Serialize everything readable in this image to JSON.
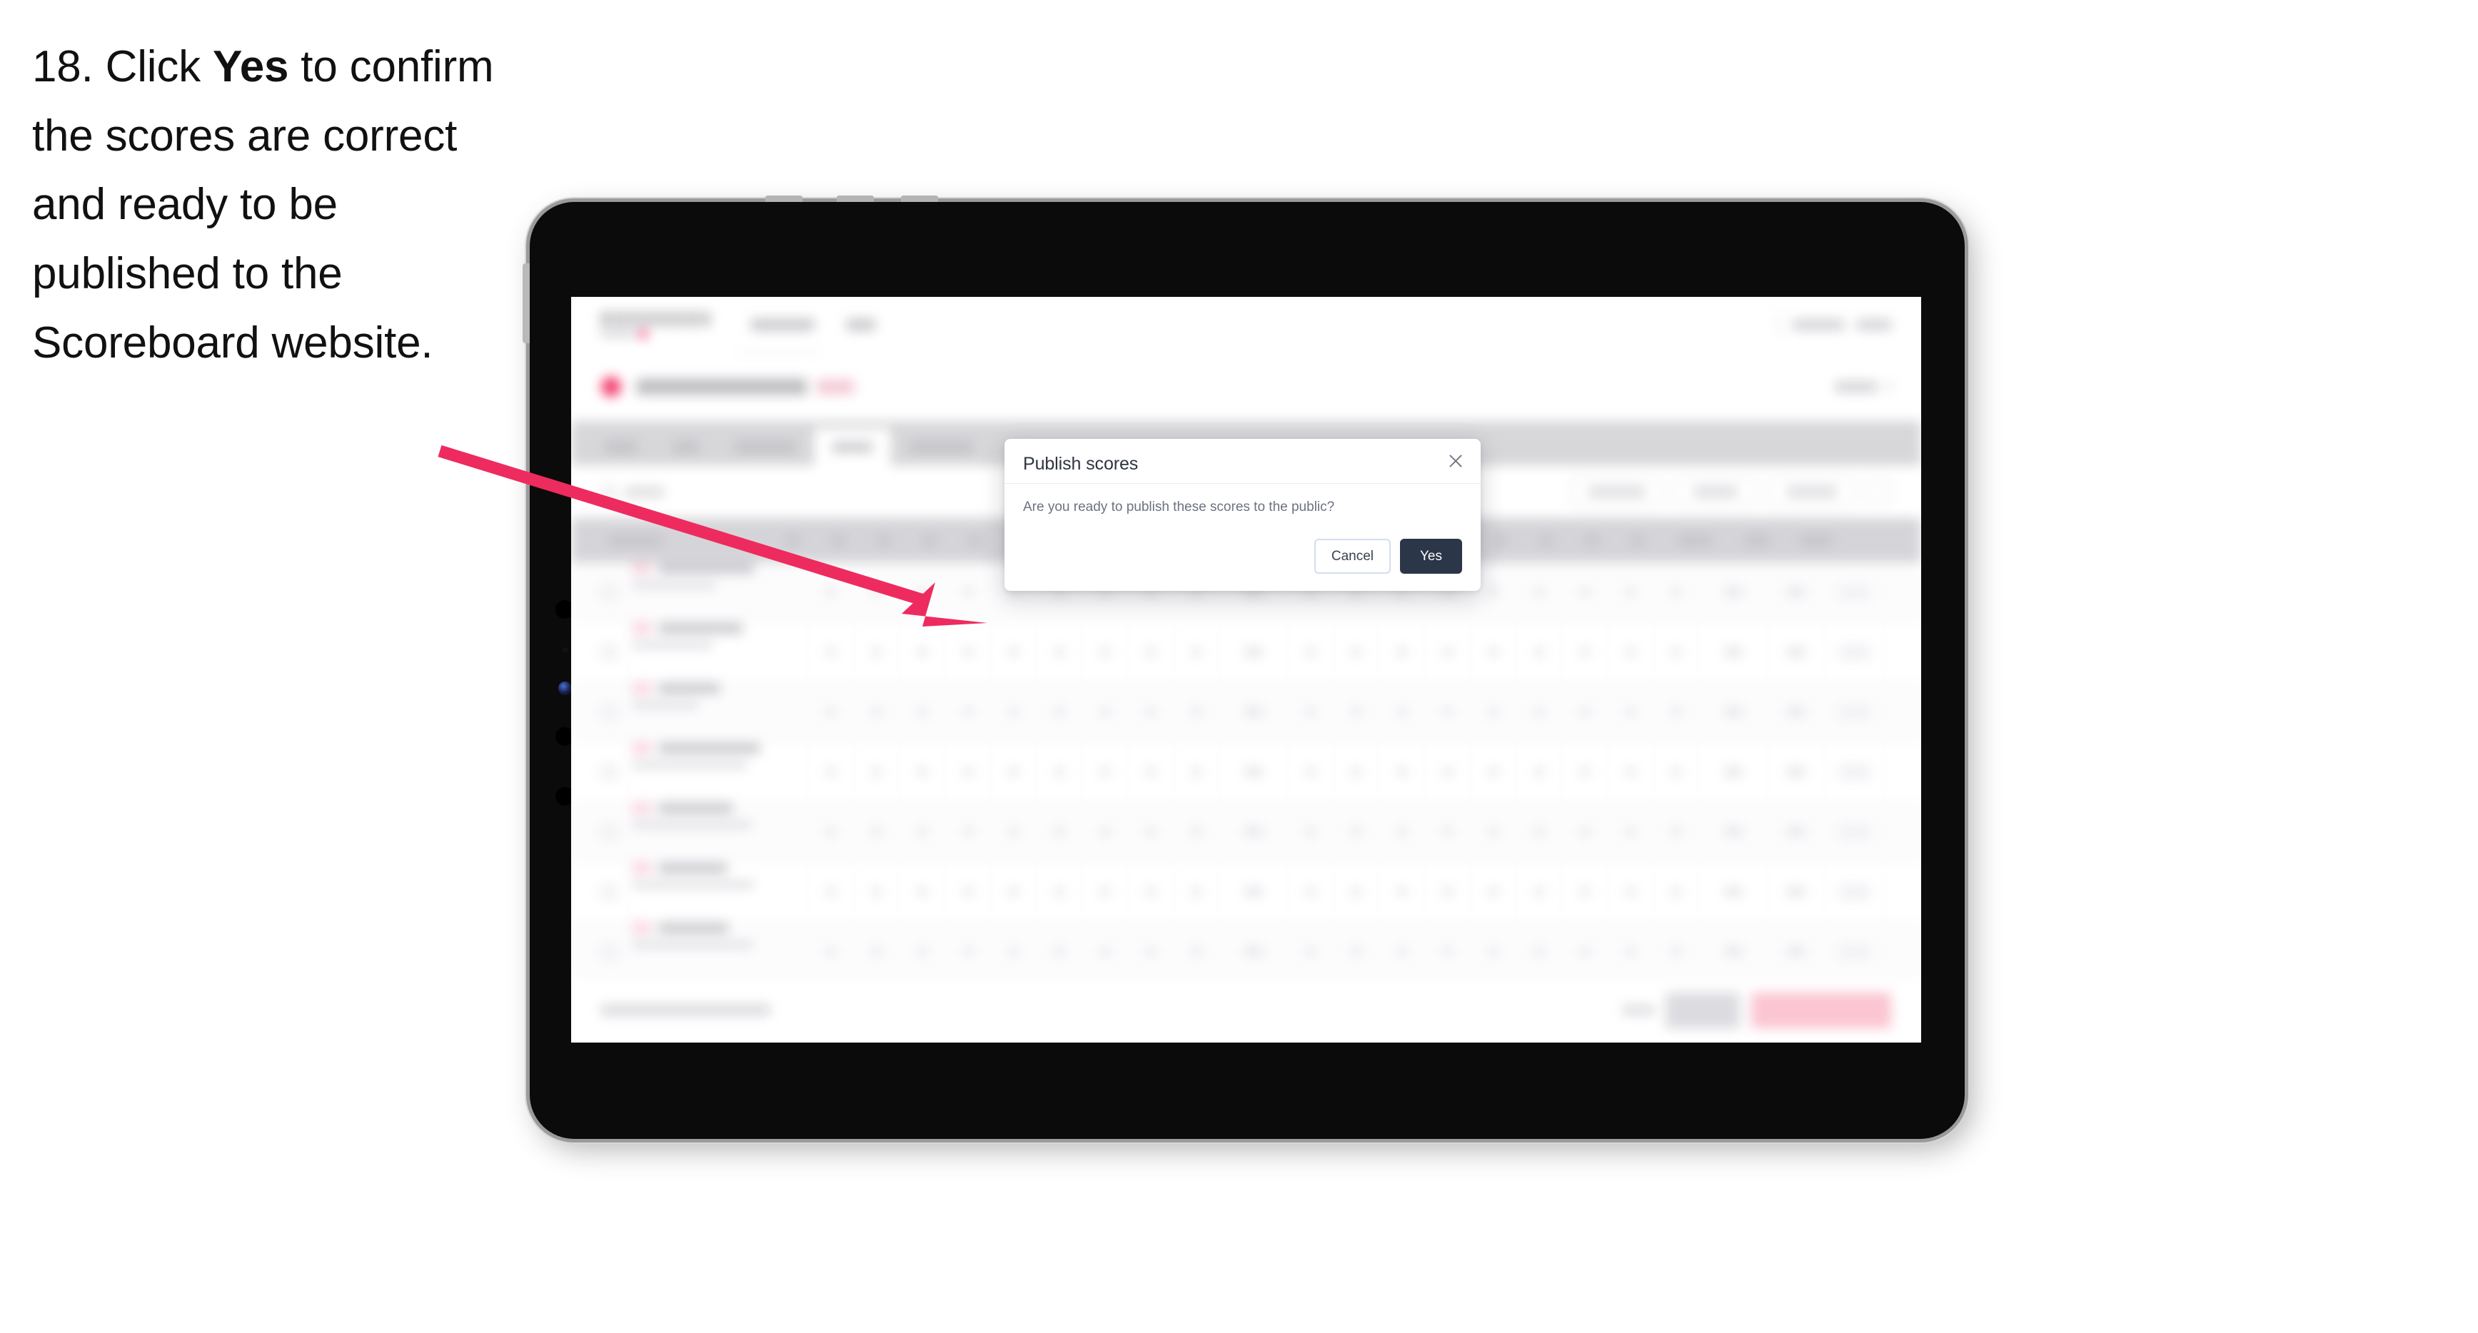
{
  "instruction": {
    "number": "18.",
    "text_before": "Click ",
    "emphasis": "Yes",
    "text_after": " to confirm the scores are correct and ready to be published to the Scoreboard website.",
    "full_text": "18. Click Yes to confirm the scores are correct and ready to be published to the Scoreboard website."
  },
  "annotation": {
    "arrow_color": "#ee2b5e",
    "points_to": "publish-scores-dialog"
  },
  "device": {
    "type": "tablet",
    "orientation": "landscape",
    "frame_color": "#0b0b0b",
    "bezel_color": "#9b9b9e"
  },
  "dialog": {
    "title": "Publish scores",
    "message": "Are you ready to publish these scores to the public?",
    "close_icon": "close-x-icon",
    "buttons": {
      "cancel": "Cancel",
      "confirm": "Yes"
    },
    "confirm_color": "#2b3648",
    "cancel_border_color": "#d4dcf0"
  },
  "background_app": {
    "state": "blurred",
    "brand_accent": "#f2295f",
    "tabs_active_index": 3,
    "tab_count": 5,
    "table_row_count": 7,
    "bottom_primary_color": "#fbbfce"
  }
}
